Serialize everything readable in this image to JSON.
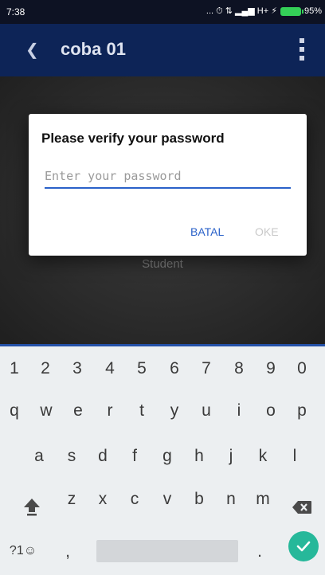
{
  "status_bar": {
    "time": "7:38",
    "indicators": "... ⏱ ⇅ ▂▄▆ H+ ⚡",
    "battery_percent": "95%"
  },
  "app_bar": {
    "back_icon": "back-chevron-icon",
    "title": "coba 01",
    "menu_icon": "overflow-menu-icon"
  },
  "background": {
    "role_label": "Student"
  },
  "dialog": {
    "title": "Please verify your password",
    "password_placeholder": "Enter your password",
    "password_value": "",
    "cancel_label": "BATAL",
    "ok_label": "OKE"
  },
  "keyboard": {
    "number_row": [
      "1",
      "2",
      "3",
      "4",
      "5",
      "6",
      "7",
      "8",
      "9",
      "0"
    ],
    "row1": [
      "q",
      "w",
      "e",
      "r",
      "t",
      "y",
      "u",
      "i",
      "o",
      "p"
    ],
    "row2": [
      "a",
      "s",
      "d",
      "f",
      "g",
      "h",
      "j",
      "k",
      "l"
    ],
    "row3": [
      "z",
      "x",
      "c",
      "v",
      "b",
      "n",
      "m"
    ],
    "symbols_label": "?1☺",
    "comma": ",",
    "period": ".",
    "accent_color": "#26b89a"
  }
}
